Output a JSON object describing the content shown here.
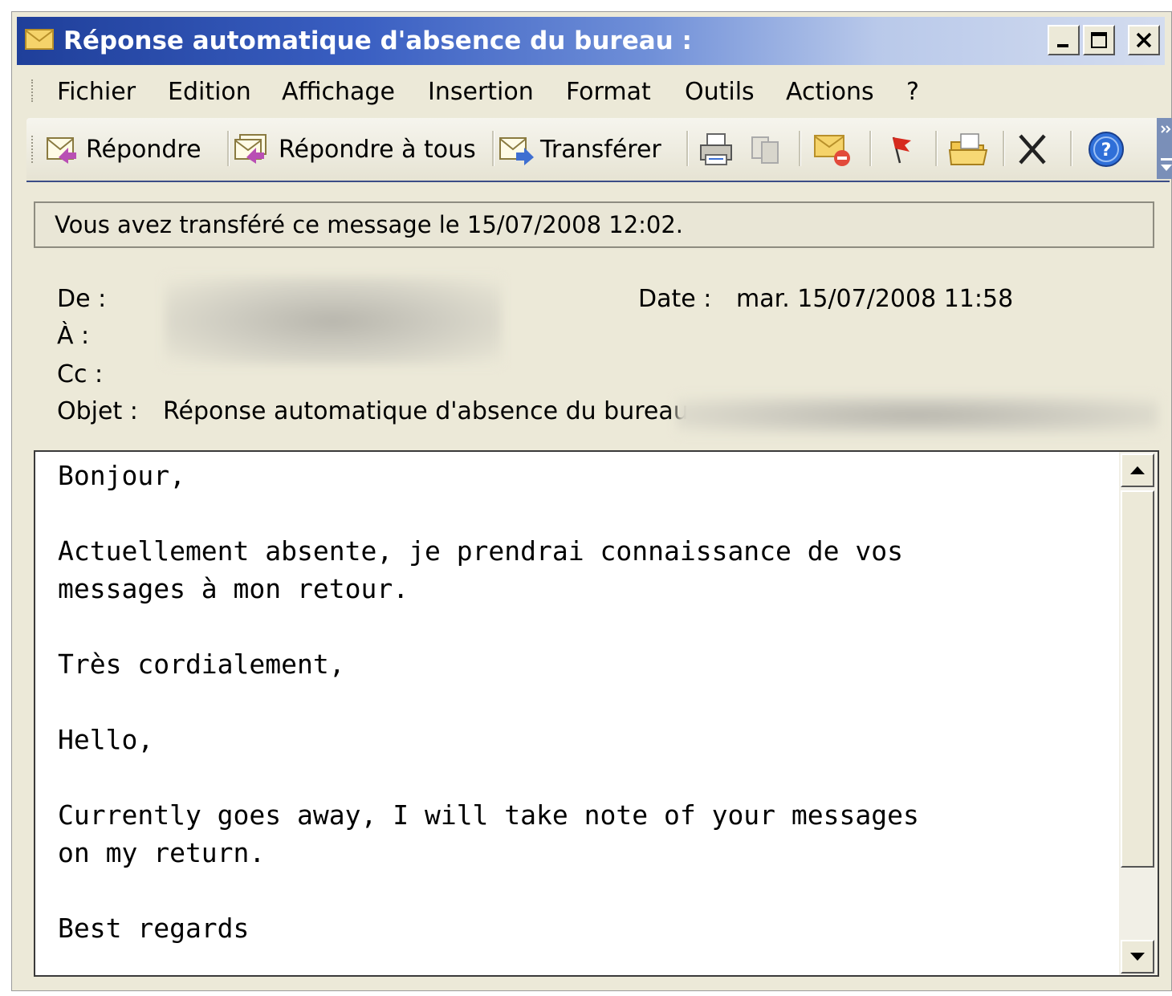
{
  "window": {
    "title": "Réponse automatique d'absence du bureau :",
    "icon": "envelope-icon"
  },
  "menu": {
    "items": [
      "Fichier",
      "Edition",
      "Affichage",
      "Insertion",
      "Format",
      "Outils",
      "Actions",
      "?"
    ]
  },
  "toolbar": {
    "reply_label": "Répondre",
    "reply_all_label": "Répondre à tous",
    "forward_label": "Transférer",
    "icons": [
      "print-icon",
      "move-to-folder-icon",
      "mark-unread-icon",
      "flag-icon",
      "open-folder-icon",
      "delete-icon",
      "help-icon"
    ]
  },
  "info_bar": {
    "text": "Vous avez transféré ce message le 15/07/2008 12:02."
  },
  "headers": {
    "from_label": "De :",
    "to_label": "À :",
    "cc_label": "Cc :",
    "subject_label": "Objet :",
    "subject_value": "Réponse automatique d'absence du bureau :",
    "date_label": "Date :",
    "date_value": "mar. 15/07/2008 11:58"
  },
  "message": {
    "body": "Bonjour,\n\nActuellement absente, je prendrai connaissance de vos\nmessages à mon retour.\n\nTrès cordialement,\n\nHello,\n\nCurrently goes away, I will take note of your messages\non my return.\n\nBest regards"
  }
}
